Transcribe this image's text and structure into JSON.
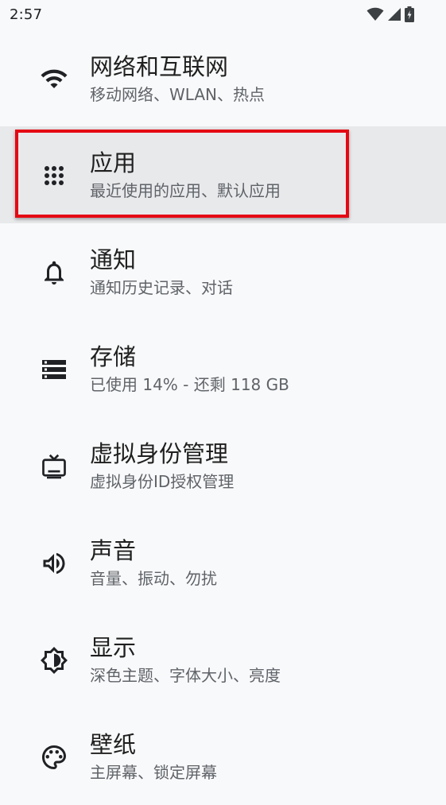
{
  "status_bar": {
    "time": "2:57",
    "icons": [
      "wifi-signal-icon",
      "cell-signal-icon",
      "battery-charging-icon"
    ]
  },
  "settings": {
    "items": [
      {
        "title": "网络和互联网",
        "subtitle": "移动网络、WLAN、热点",
        "icon": "wifi-icon"
      },
      {
        "title": "应用",
        "subtitle": "最近使用的应用、默认应用",
        "icon": "apps-grid-icon"
      },
      {
        "title": "通知",
        "subtitle": "通知历史记录、对话",
        "icon": "bell-icon"
      },
      {
        "title": "存储",
        "subtitle": "已使用 14% - 还剩 118 GB",
        "icon": "storage-icon"
      },
      {
        "title": "虚拟身份管理",
        "subtitle": "虚拟身份ID授权管理",
        "icon": "tv-icon"
      },
      {
        "title": "声音",
        "subtitle": "音量、振动、勿扰",
        "icon": "volume-icon"
      },
      {
        "title": "显示",
        "subtitle": "深色主题、字体大小、亮度",
        "icon": "brightness-icon"
      },
      {
        "title": "壁纸",
        "subtitle": "主屏幕、锁定屏幕",
        "icon": "palette-icon"
      }
    ]
  },
  "highlight": {
    "target": "应用",
    "color": "#e50914"
  }
}
